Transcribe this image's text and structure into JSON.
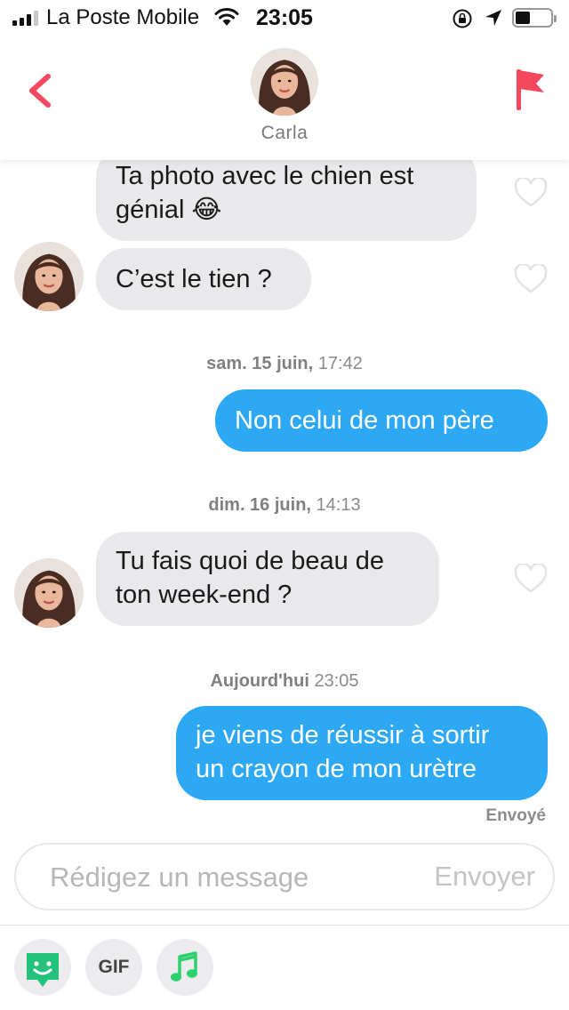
{
  "status_bar": {
    "carrier": "La Poste Mobile",
    "time": "23:05"
  },
  "header": {
    "contact_name": "Carla",
    "icons": [
      "back-chevron-icon",
      "report-flag-icon"
    ],
    "accent_color": "#f5475e"
  },
  "messages": [
    {
      "direction": "in",
      "lines": [
        "Ta photo avec le chien est",
        "génial 😂"
      ]
    },
    {
      "direction": "in",
      "lines": [
        "C’est le tien ?"
      ]
    },
    {
      "type": "date",
      "day": "sam. 15 juin,",
      "time": "17:42"
    },
    {
      "direction": "out",
      "lines": [
        "Non celui de mon père"
      ]
    },
    {
      "type": "date",
      "day": "dim. 16 juin,",
      "time": "14:13"
    },
    {
      "direction": "in",
      "lines": [
        "Tu fais quoi de beau de",
        "ton week-end ?"
      ]
    },
    {
      "type": "date",
      "day": "Aujourd'hui",
      "time": "23:05"
    },
    {
      "direction": "out",
      "lines": [
        "je viens de réussir à sortir",
        "un crayon de mon urètre"
      ]
    }
  ],
  "delivery_status": "Envoyé",
  "composer": {
    "placeholder": "Rédigez un message",
    "value": "",
    "send_label": "Envoyer"
  },
  "toolbar": {
    "sticker_icon": "smiley-sticker-icon",
    "gif_label": "GIF",
    "music_icon": "music-note-icon"
  },
  "colors": {
    "outgoing_bubble": "#2ca8f5",
    "incoming_bubble": "#e9e9eb",
    "sticker_green": "#24c27a",
    "music_green": "#2bd16c"
  }
}
